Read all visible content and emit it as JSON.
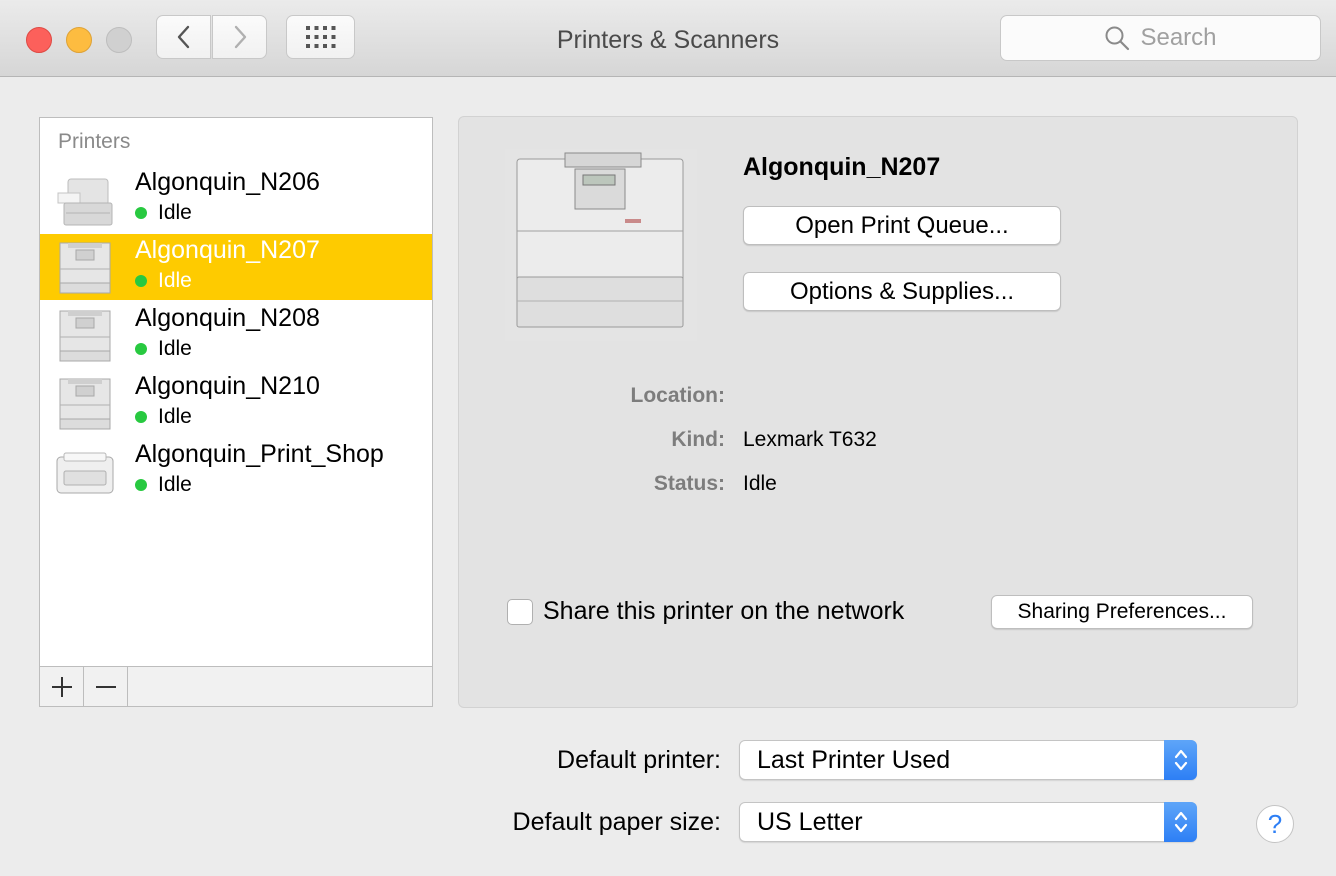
{
  "window": {
    "title": "Printers & Scanners"
  },
  "search": {
    "placeholder": "Search"
  },
  "printer_list": {
    "header": "Printers",
    "items": [
      {
        "name": "Algonquin_N206",
        "status": "Idle",
        "icon": "printer-large-icon",
        "selected": false
      },
      {
        "name": "Algonquin_N207",
        "status": "Idle",
        "icon": "printer-icon",
        "selected": true
      },
      {
        "name": "Algonquin_N208",
        "status": "Idle",
        "icon": "printer-icon",
        "selected": false
      },
      {
        "name": "Algonquin_N210",
        "status": "Idle",
        "icon": "printer-icon",
        "selected": false
      },
      {
        "name": "Algonquin_Print_Shop",
        "status": "Idle",
        "icon": "printer-desktop-icon",
        "selected": false
      }
    ]
  },
  "detail": {
    "printer_name": "Algonquin_N207",
    "open_queue_label": "Open Print Queue...",
    "options_label": "Options & Supplies...",
    "location_label": "Location:",
    "location_value": "",
    "kind_label": "Kind:",
    "kind_value": "Lexmark T632",
    "status_label": "Status:",
    "status_value": "Idle",
    "share_label": "Share this printer on the network",
    "share_checked": false,
    "sharing_prefs_label": "Sharing Preferences..."
  },
  "defaults": {
    "printer_label": "Default printer:",
    "printer_value": "Last Printer Used",
    "paper_label": "Default paper size:",
    "paper_value": "US Letter"
  },
  "help_label": "?",
  "colors": {
    "selection": "#fecb00",
    "status_idle": "#28c940",
    "accent": "#2d7ff5"
  }
}
